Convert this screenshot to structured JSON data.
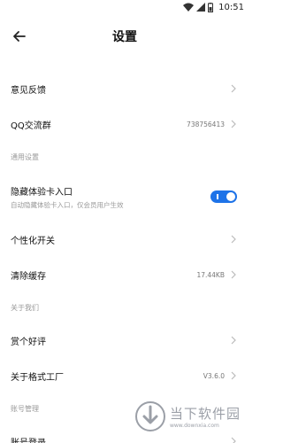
{
  "status_bar": {
    "time": "10:51"
  },
  "header": {
    "title": "设置"
  },
  "rows": {
    "feedback": {
      "label": "意见反馈"
    },
    "qq_group": {
      "label": "QQ交流群",
      "value": "738756413"
    },
    "hide_card": {
      "label": "隐藏体验卡入口",
      "sub": "自动隐藏体验卡入口，仅会员用户生效",
      "enabled": true
    },
    "personal": {
      "label": "个性化开关"
    },
    "cache": {
      "label": "清除缓存",
      "value": "17.44KB"
    },
    "rate": {
      "label": "赏个好评"
    },
    "about": {
      "label": "关于格式工厂",
      "value": "V3.6.0"
    },
    "login": {
      "label": "账号登录"
    }
  },
  "sections": {
    "general": "通用设置",
    "about_us": "关于我们",
    "account": "账号管理"
  },
  "watermark": {
    "title": "当下软件园",
    "url": "www.downxia.com"
  },
  "colors": {
    "accent": "#1e73e8"
  }
}
